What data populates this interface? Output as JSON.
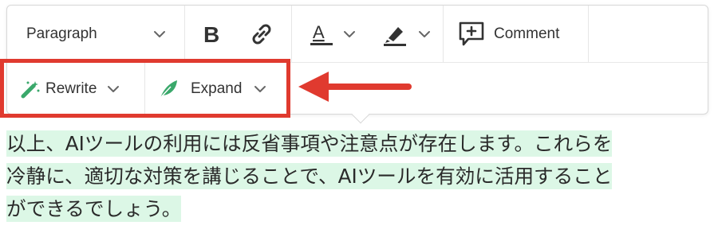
{
  "toolbar": {
    "block_type": "Paragraph",
    "comment_label": "Comment",
    "rewrite_label": "Rewrite",
    "expand_label": "Expand"
  },
  "colors": {
    "highlight_box": "#e03a2f",
    "text_highlight": "#dcf7e6",
    "ai_icon_green": "#3aa86b"
  },
  "icons": [
    "chevron-down-icon",
    "bold-icon",
    "link-icon",
    "text-color-icon",
    "highlighter-icon",
    "comment-icon",
    "magic-wand-icon",
    "feather-icon",
    "arrow-left-icon"
  ],
  "content": {
    "lines": [
      "以上、AIツールの利用には反省事項や注意点が存在します。これらを",
      "冷静に、適切な対策を講じることで、AIツールを有効に活用すること",
      "ができるでしょう。"
    ]
  }
}
